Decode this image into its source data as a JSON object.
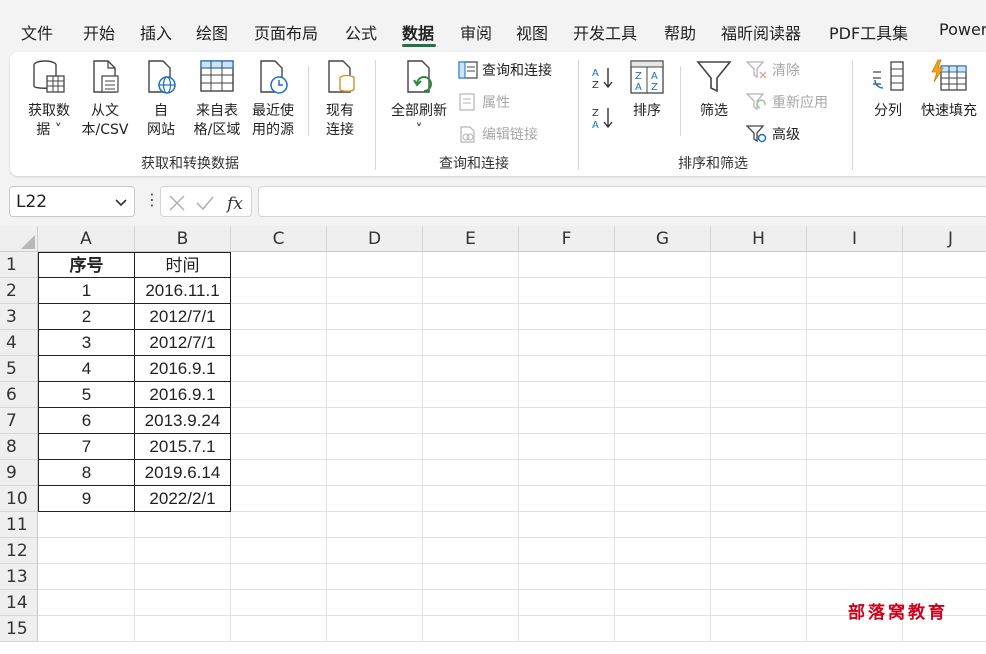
{
  "menu": {
    "items": [
      "文件",
      "开始",
      "插入",
      "绘图",
      "页面布局",
      "公式",
      "数据",
      "审阅",
      "视图",
      "开发工具",
      "帮助",
      "福昕阅读器",
      "PDF工具集",
      "Power"
    ],
    "active": "数据"
  },
  "ribbon": {
    "get_data": {
      "label": "获取和转换数据",
      "buttons": [
        {
          "line1": "获取数",
          "line2": "据 ˅"
        },
        {
          "line1": "从文",
          "line2": "本/CSV"
        },
        {
          "line1": "自",
          "line2": "网站"
        },
        {
          "line1": "来自表",
          "line2": "格/区域"
        },
        {
          "line1": "最近使",
          "line2": "用的源"
        },
        {
          "line1": "现有",
          "line2": "连接"
        }
      ]
    },
    "queries": {
      "label": "查询和连接",
      "refresh_all": "全部刷新",
      "refresh_arrow": "˅",
      "queries_connections": "查询和连接",
      "properties": "属性",
      "edit_links": "编辑链接"
    },
    "sort_filter": {
      "label": "排序和筛选",
      "sort": "排序",
      "filter": "筛选",
      "clear": "清除",
      "reapply": "重新应用",
      "advanced": "高级"
    },
    "data_tools": {
      "text_to_columns": "分列",
      "flash_fill": "快速填充"
    }
  },
  "formula_bar": {
    "name_box": "L22",
    "formula": ""
  },
  "columns": [
    "A",
    "B",
    "C",
    "D",
    "E",
    "F",
    "G",
    "H",
    "I",
    "J"
  ],
  "rows": [
    "1",
    "2",
    "3",
    "4",
    "5",
    "6",
    "7",
    "8",
    "9",
    "10",
    "11",
    "12",
    "13",
    "14",
    "15"
  ],
  "table": {
    "headers": [
      "序号",
      "时间"
    ],
    "rows": [
      [
        "1",
        "2016.11.1"
      ],
      [
        "2",
        "2012/7/1"
      ],
      [
        "3",
        "2012/7/1"
      ],
      [
        "4",
        "2016.9.1"
      ],
      [
        "5",
        "2016.9.1"
      ],
      [
        "6",
        "2013.9.24"
      ],
      [
        "7",
        "2015.7.1"
      ],
      [
        "8",
        "2019.6.14"
      ],
      [
        "9",
        "2022/2/1"
      ]
    ]
  },
  "watermark": "部落窝教育",
  "colors": {
    "accent": "#217346",
    "watermark": "#d0021b",
    "icon_blue": "#1e6fbf",
    "icon_green": "#2e8b3c"
  }
}
